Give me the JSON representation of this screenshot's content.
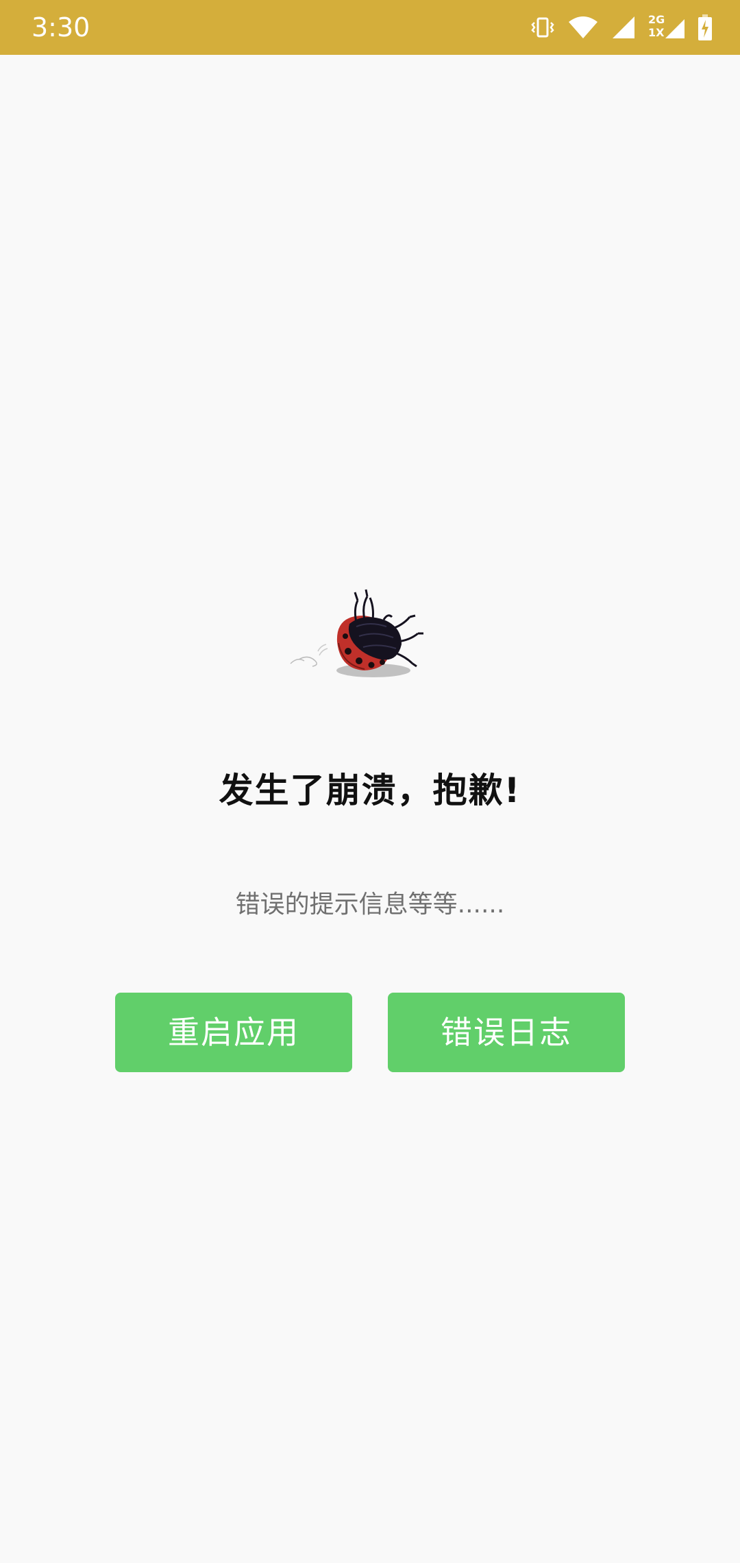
{
  "status_bar": {
    "time": "3:30",
    "network_label_top": "2G",
    "network_label_bottom": "1X",
    "background_color": "#d4ae3b",
    "icons": [
      "vibrate-icon",
      "wifi-icon",
      "signal-icon",
      "signal-2g-icon",
      "battery-charging-icon"
    ]
  },
  "illustration": {
    "icon": "overturned-ladybug-illustration"
  },
  "crash": {
    "title": "发生了崩溃，抱歉!",
    "message": "错误的提示信息等等......"
  },
  "actions": {
    "restart_label": "重启应用",
    "log_label": "错误日志",
    "button_color": "#61cf6a"
  }
}
